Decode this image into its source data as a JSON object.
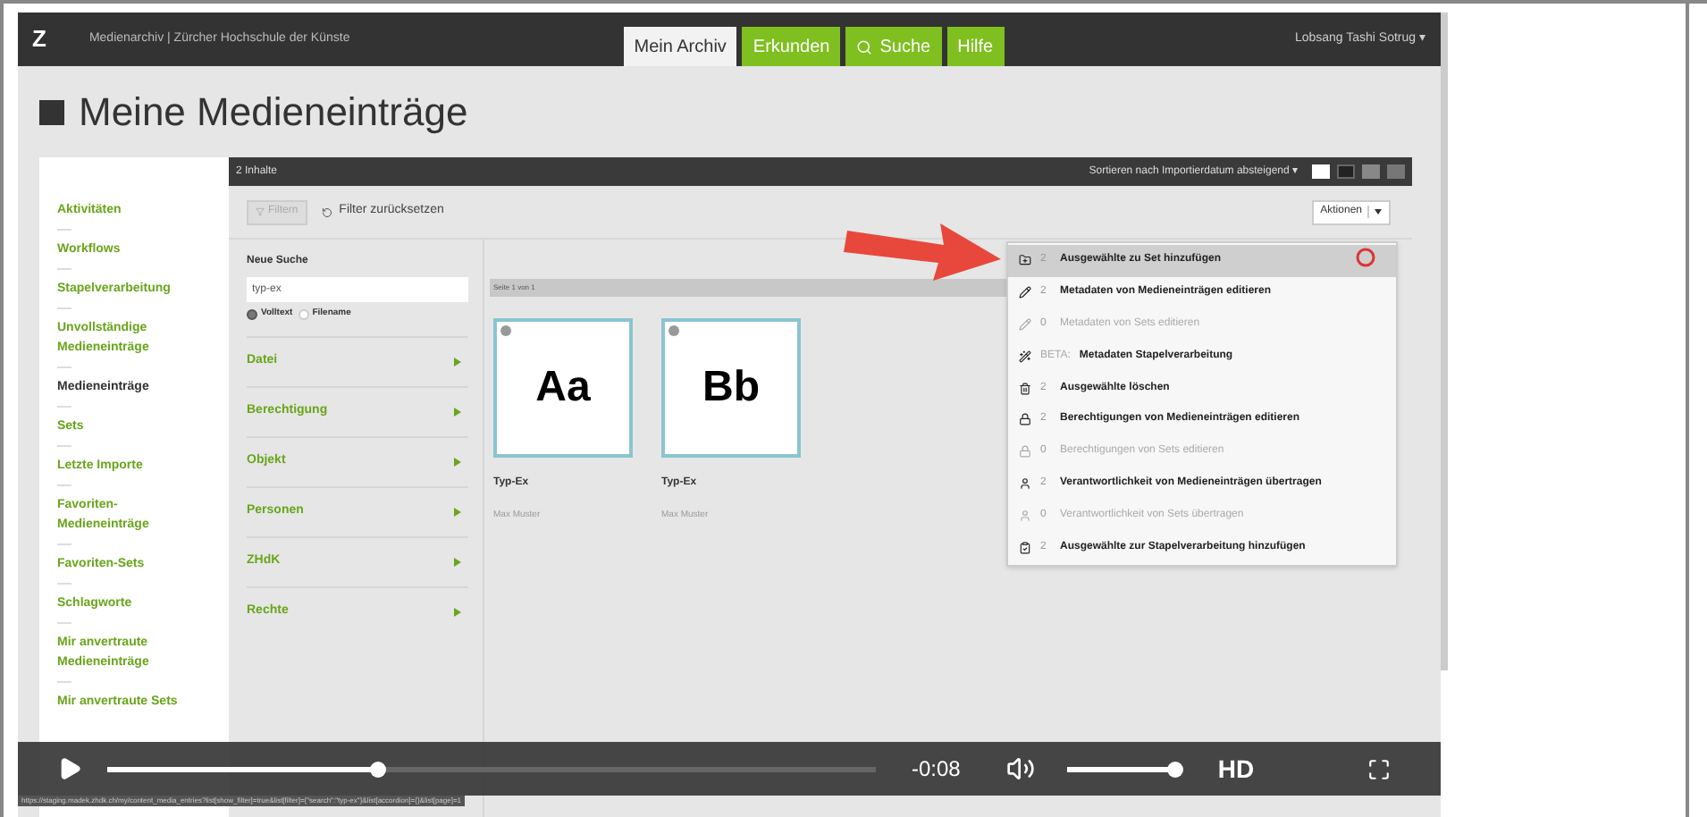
{
  "app": {
    "site_title": "Medienarchiv | Zürcher Hochschule der Künste",
    "logo": "Z",
    "user": "Lobsang Tashi Sotrug ▾"
  },
  "nav_tabs": [
    {
      "label": "Mein Archiv",
      "selected": true,
      "kind": "text"
    },
    {
      "label": "Erkunden",
      "selected": false,
      "kind": "text"
    },
    {
      "label": "Suche",
      "selected": false,
      "kind": "search"
    },
    {
      "label": "Hilfe",
      "selected": false,
      "kind": "text"
    }
  ],
  "page_title": "Meine Medieneinträge",
  "sidebar": {
    "items": [
      {
        "label": "Aktivitäten",
        "selected": false
      },
      {
        "label": "Workflows",
        "selected": false
      },
      {
        "label": "Stapelverarbeitung",
        "selected": false
      },
      {
        "label": "Unvollständige Medieneinträge",
        "selected": false
      },
      {
        "label": "Medieneinträge",
        "selected": true
      },
      {
        "label": "Sets",
        "selected": false
      },
      {
        "label": "Letzte Importe",
        "selected": false
      },
      {
        "label": "Favoriten-Medieneinträge",
        "selected": false
      },
      {
        "label": "Favoriten-Sets",
        "selected": false
      },
      {
        "label": "Schlagworte",
        "selected": false
      },
      {
        "label": "Mir anvertraute Medieneinträge",
        "selected": false
      },
      {
        "label": "Mir anvertraute Sets",
        "selected": false
      }
    ]
  },
  "panel": {
    "count": "2 Inhalte",
    "sort": "Sortieren nach Importierdatum absteigend ▾",
    "filter_button": "Filtern",
    "reset": "Filter zurücksetzen",
    "actions": "Aktionen",
    "page": "Seite 1 von 1"
  },
  "search": {
    "heading": "Neue Suche",
    "value": "typ-ex",
    "options": [
      {
        "label": "Volltext",
        "selected": true
      },
      {
        "label": "Filename",
        "selected": false
      }
    ]
  },
  "filters": [
    "Datei",
    "Berechtigung",
    "Objekt",
    "Personen",
    "ZHdK",
    "Rechte"
  ],
  "entries": [
    {
      "thumb": "Aa",
      "title": "Typ-Ex",
      "author": "Max Muster"
    },
    {
      "thumb": "Bb",
      "title": "Typ-Ex",
      "author": "Max Muster"
    }
  ],
  "actions_menu": [
    {
      "kind": "set",
      "count": "2",
      "label": "Ausgewählte zu Set hinzufügen",
      "disabled": false,
      "highlighted": true
    },
    {
      "kind": "pencil",
      "count": "2",
      "label": "Metadaten von Medieneinträgen editieren",
      "disabled": false,
      "highlighted": false
    },
    {
      "kind": "pencil",
      "count": "0",
      "label": "Metadaten von Sets editieren",
      "disabled": true,
      "highlighted": false
    },
    {
      "kind": "wand",
      "prefix": "BETA:",
      "label": "Metadaten Stapelverarbeitung",
      "disabled": false,
      "highlighted": false
    },
    {
      "kind": "trash",
      "count": "2",
      "label": "Ausgewählte löschen",
      "disabled": false,
      "highlighted": false
    },
    {
      "kind": "lock",
      "count": "2",
      "label": "Berechtigungen von Medieneinträgen editieren",
      "disabled": false,
      "highlighted": false
    },
    {
      "kind": "lock",
      "count": "0",
      "label": "Berechtigungen von Sets editieren",
      "disabled": true,
      "highlighted": false
    },
    {
      "kind": "person",
      "count": "2",
      "label": "Verantwortlichkeit von Medieneinträgen übertragen",
      "disabled": false,
      "highlighted": false
    },
    {
      "kind": "person",
      "count": "0",
      "label": "Verantwortlichkeit von Sets übertragen",
      "disabled": true,
      "highlighted": false
    },
    {
      "kind": "clipboard",
      "count": "2",
      "label": "Ausgewählte zur Stapelverarbeitung hinzufügen",
      "disabled": false,
      "highlighted": false
    }
  ],
  "status_url": "https://staging.madek.zhdk.ch/my/content_media_entries?list[show_filter]=true&list[filter]={\"search\":\"typ-ex\"}&list[accordion]={}&list[page]=1",
  "player": {
    "progress": {
      "level": 0.35
    },
    "time": "-0:08",
    "volume": {
      "level": 1
    },
    "quality": "HD"
  }
}
